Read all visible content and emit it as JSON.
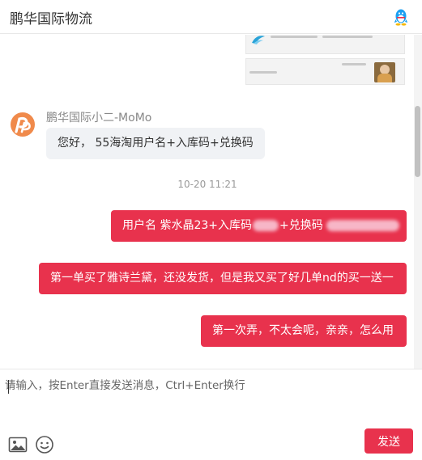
{
  "header": {
    "title": "鹏华国际物流",
    "qq_icon": "qq-penguin-icon",
    "accent": "#1ba0f2"
  },
  "messages": {
    "agent": {
      "name": "鹏华国际小二-MoMo",
      "avatar_icon": "penghua-logo-avatar",
      "text": "您好， 55海淘用户名+入库码+兑换码"
    },
    "timestamp": "10-20 11:21",
    "outgoing": [
      {
        "before_redaction": "用户名 紫水晶23+入库码",
        "after_redaction": "+兑换码"
      },
      {
        "text": "第一单买了雅诗兰黛，还没发货，但是我又买了好几单nd的买一送一"
      },
      {
        "text": "第一次弄，不太会呢，亲亲，怎么用"
      }
    ]
  },
  "composer": {
    "placeholder": "请输入，按Enter直接发送消息，Ctrl+Enter换行",
    "value": "",
    "image_icon": "image-icon",
    "emoji_icon": "emoji-icon",
    "send_label": "发送"
  },
  "colors": {
    "brand": "#e8324d",
    "agent_bubble": "#f0f2f5",
    "timestamp": "#999999"
  }
}
